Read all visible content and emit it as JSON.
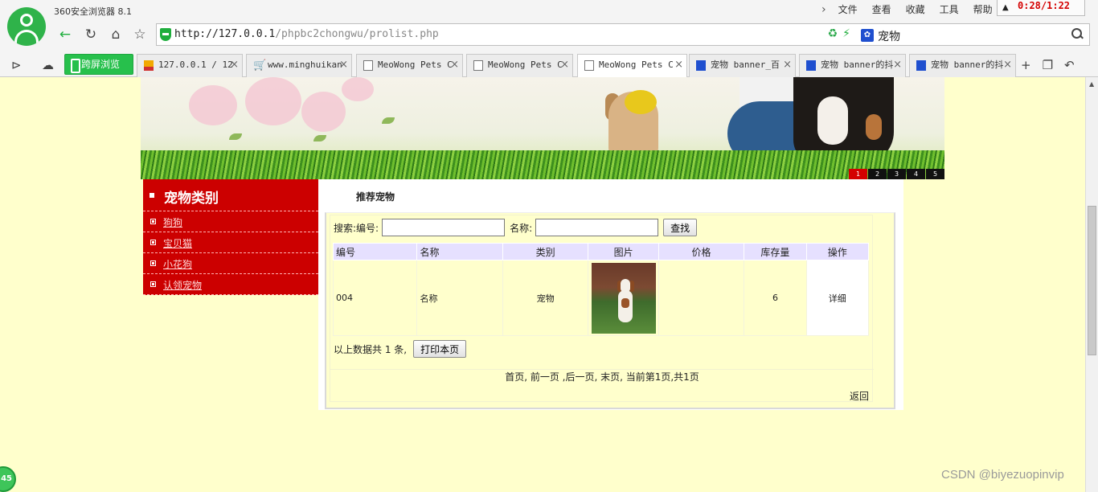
{
  "browser": {
    "app_title": "360安全浏览器 8.1",
    "menu": [
      "文件",
      "查看",
      "收藏",
      "工具",
      "帮助"
    ],
    "clock": "0:28/1:22",
    "url": {
      "scheme_host": "http://127.0.0.1",
      "path": "/phpbc2chongwu/prolist.php"
    },
    "search_engine_text": "宠物",
    "split_view_label": "跨屏浏览",
    "tabs": [
      {
        "title": "127.0.0.1 / 12",
        "icon": "phpmyadmin-icon"
      },
      {
        "title": "www.minghuikan",
        "icon": "cart-icon"
      },
      {
        "title": "MeoWong Pets C",
        "icon": "page-icon"
      },
      {
        "title": "MeoWong Pets C",
        "icon": "page-icon"
      },
      {
        "title": "MeoWong Pets C",
        "icon": "page-icon",
        "active": true
      },
      {
        "title": "宠物 banner_百",
        "icon": "baidu-paw-icon"
      },
      {
        "title": "宠物 banner的抖",
        "icon": "baidu-paw-icon"
      },
      {
        "title": "宠物 banner的抖",
        "icon": "baidu-paw-icon"
      }
    ]
  },
  "banner": {
    "slides": [
      "1",
      "2",
      "3",
      "4",
      "5"
    ],
    "active_slide": 1
  },
  "sidebar": {
    "title": "宠物类别",
    "items": [
      "狗狗",
      "宝贝猫",
      "小花狗",
      "认领宠物"
    ]
  },
  "main": {
    "section_title": "推荐宠物",
    "search": {
      "label_id": "搜索:编号:",
      "label_name": "名称:",
      "id_value": "",
      "name_value": "",
      "button": "查找"
    },
    "table": {
      "headers": [
        "编号",
        "名称",
        "类别",
        "图片",
        "价格",
        "库存量",
        "操作"
      ],
      "rows": [
        {
          "id": "004",
          "name": "名称",
          "category": "宠物",
          "image": "beagle-dog-photo",
          "price": "",
          "stock": "6",
          "action": "详细"
        }
      ]
    },
    "summary_text": "以上数据共 1 条,",
    "print_button": "打印本页",
    "pager": "首页, 前一页 ,后一页, 末页, 当前第1页,共1页",
    "back_link": "返回"
  },
  "overlay": {
    "watermark": "CSDN @biyezuopinvip",
    "badge": "45"
  },
  "colors": {
    "page_bg": "#ffffcc",
    "sidebar_red": "#cc0000",
    "table_header": "#e6e0ff",
    "browser_green": "#27c04c",
    "clock_red": "#d40000"
  }
}
